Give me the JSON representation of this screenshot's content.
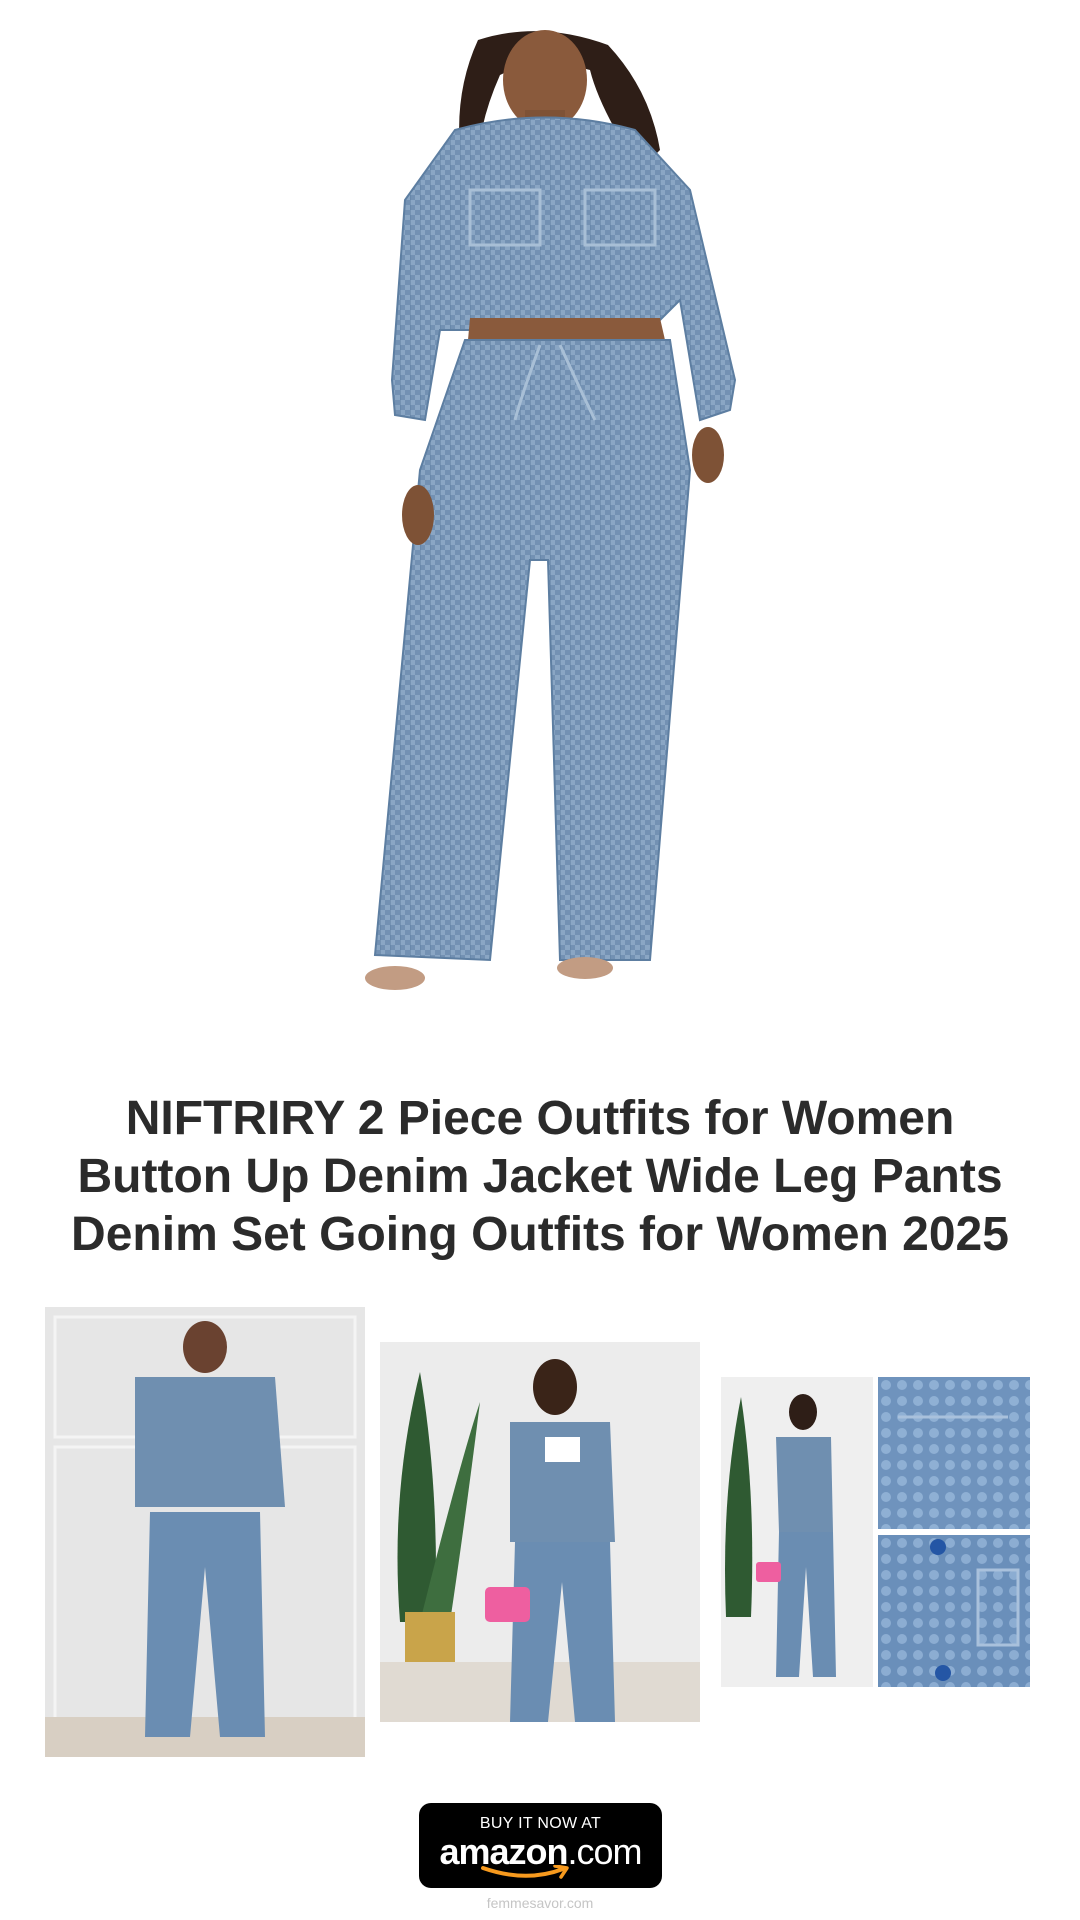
{
  "product": {
    "title_lines": [
      "NIFTRIRY 2 Piece Outfits for Women",
      "Button Up Denim Jacket Wide Leg Pants",
      "Denim Set Going Outfits for Women 2025"
    ]
  },
  "cta": {
    "top_text": "BUY IT NOW AT",
    "brand_main": "amazon",
    "brand_suffix": ".com"
  },
  "footer": {
    "domain": "femmesavor.com"
  },
  "colors": {
    "background": "#ffffff",
    "title": "#2b2b2b",
    "denim": "#6f8fb0",
    "button": "#000000",
    "amazon_smile": "#f79a1e",
    "footer_text": "#c5c5c5"
  }
}
